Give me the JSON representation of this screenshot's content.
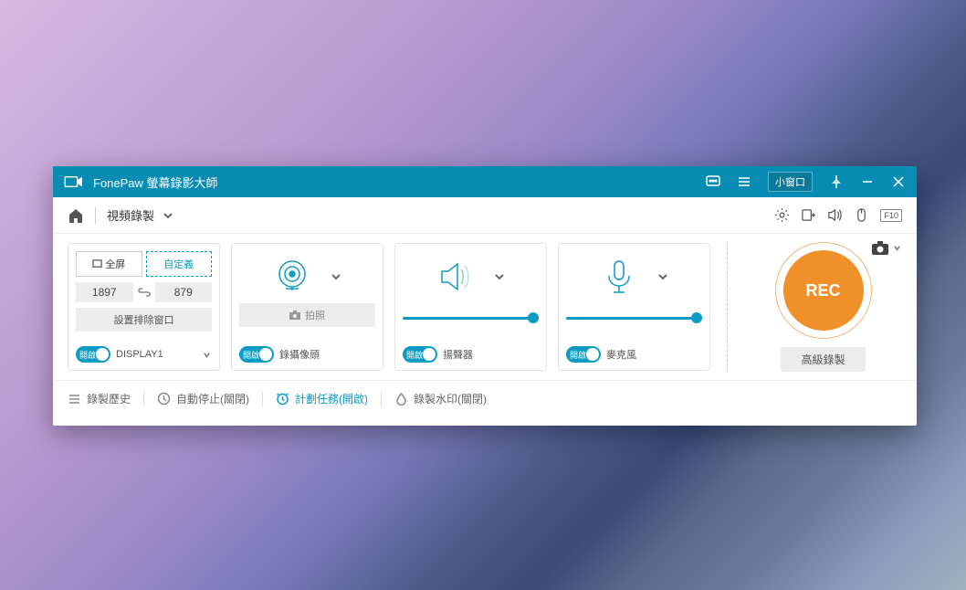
{
  "titlebar": {
    "app_title": "FonePaw 螢幕錄影大師",
    "small_window": "小窗口"
  },
  "topbar": {
    "mode": "視頻錄製",
    "hotkey": "F10"
  },
  "panel_screen": {
    "fullscreen": "全屏",
    "custom": "自定義",
    "width": "1897",
    "height": "879",
    "exclude": "設置排除窗口",
    "toggle": "開啟",
    "display": "DISPLAY1"
  },
  "panel_webcam": {
    "photo": "拍照",
    "toggle": "開啟",
    "label": "錄攝像頭"
  },
  "panel_speaker": {
    "toggle": "開啟",
    "label": "揚聲器"
  },
  "panel_mic": {
    "toggle": "開啟",
    "label": "麥克風"
  },
  "rec": {
    "button": "REC",
    "advanced": "高級錄製"
  },
  "footer": {
    "history": "錄製歷史",
    "autostop": "自動停止(關閉)",
    "schedule": "計劃任務(開啟)",
    "watermark": "錄製水印(關閉)"
  }
}
